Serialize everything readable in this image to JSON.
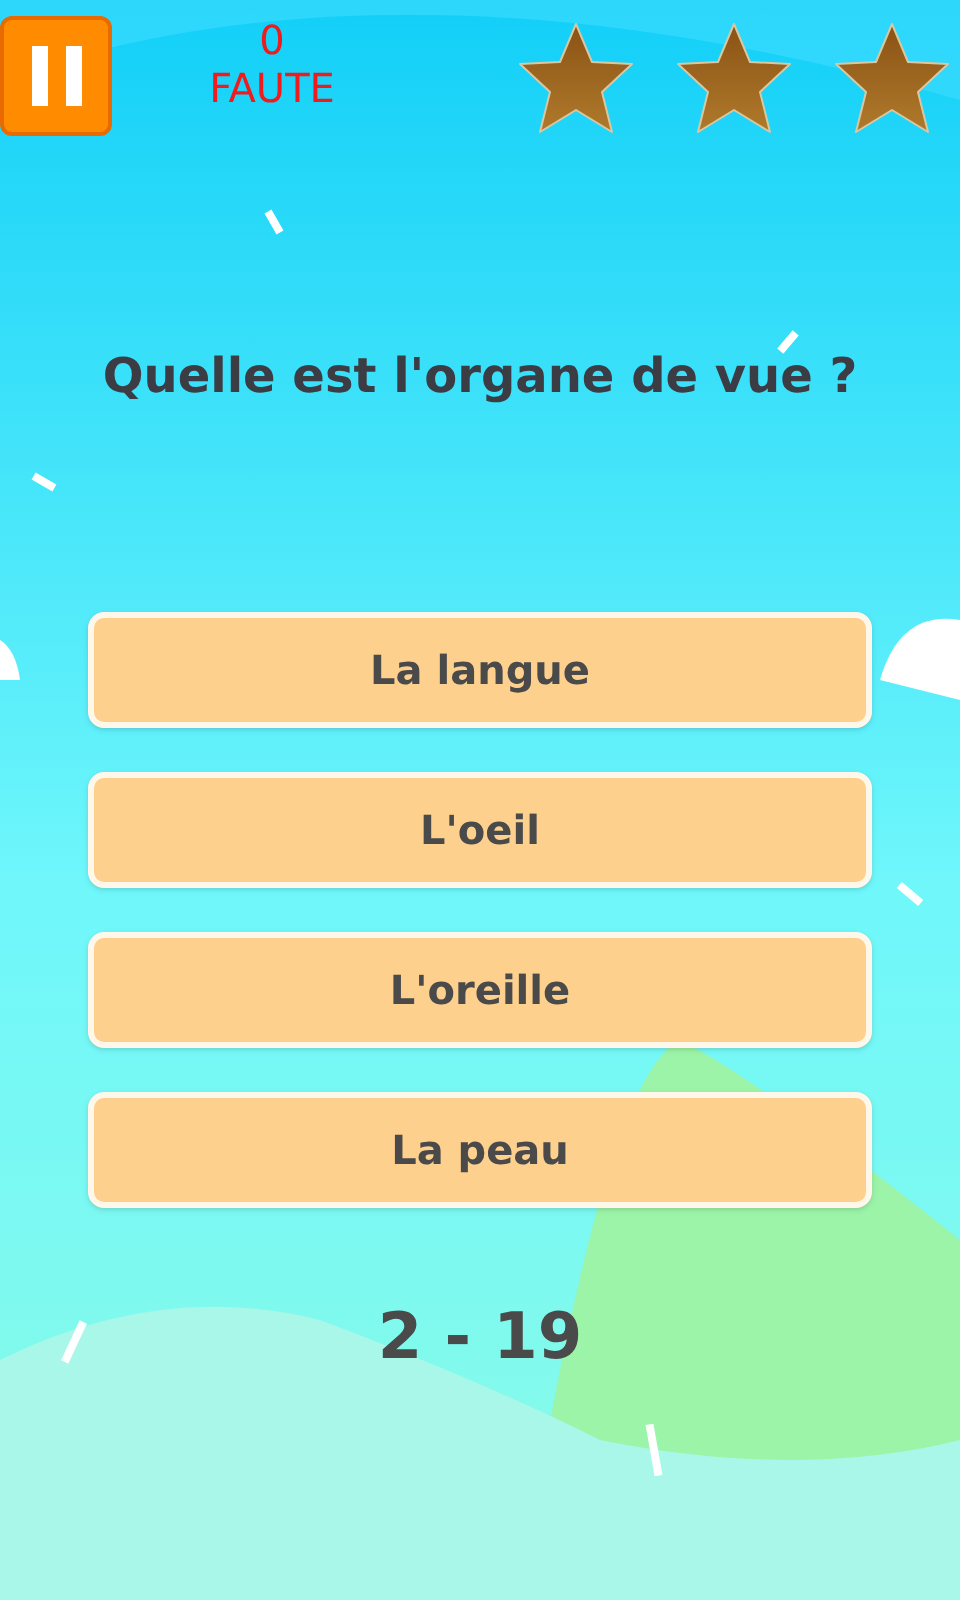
{
  "mistakes": {
    "count": "0",
    "label": "FAUTE"
  },
  "stars": 3,
  "question": "Quelle est l'organe de vue ?",
  "answers": [
    {
      "label": "La langue"
    },
    {
      "label": "L'oeil"
    },
    {
      "label": "L'oreille"
    },
    {
      "label": "La peau"
    }
  ],
  "progress": "2 - 19"
}
